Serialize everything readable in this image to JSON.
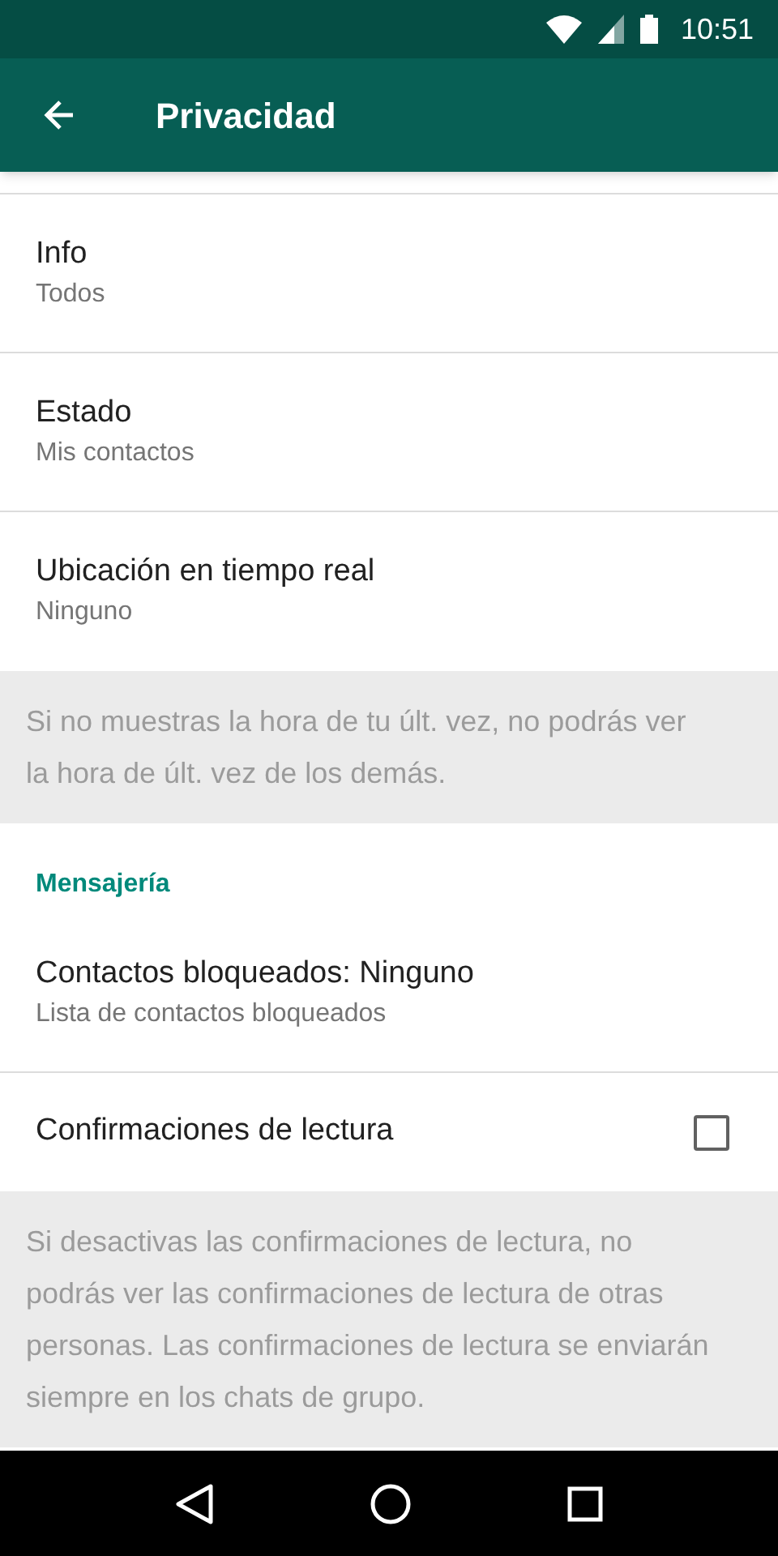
{
  "status_bar": {
    "time": "10:51"
  },
  "app_bar": {
    "title": "Privacidad"
  },
  "rows": [
    {
      "kind": "setting",
      "title": "Info",
      "subtitle": "Todos"
    },
    {
      "kind": "setting",
      "title": "Estado",
      "subtitle": "Mis contactos"
    },
    {
      "kind": "setting",
      "title": "Ubicación en tiempo real",
      "subtitle": "Ninguno"
    },
    {
      "kind": "note",
      "text": "Si no muestras la hora de tu últ. vez, no podrás ver la hora de últ. vez de los demás."
    },
    {
      "kind": "header",
      "text": "Mensajería"
    },
    {
      "kind": "setting",
      "title": "Contactos bloqueados: Ninguno",
      "subtitle": "Lista de contactos bloqueados"
    },
    {
      "kind": "checkbox",
      "title": "Confirmaciones de lectura",
      "checked": false
    },
    {
      "kind": "note",
      "text": "Si desactivas las confirmaciones de lectura, no podrás ver las confirmaciones de lectura de otras personas. Las confirmaciones de lectura se enviarán siempre en los chats de grupo."
    }
  ]
}
